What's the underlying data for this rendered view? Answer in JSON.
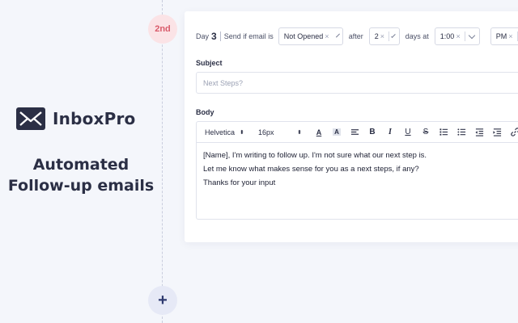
{
  "brand": {
    "name": "InboxPro",
    "tagline_line1": "Automated",
    "tagline_line2": "Follow-up emails"
  },
  "timeline": {
    "step_label": "2nd",
    "add_symbol": "+"
  },
  "rule": {
    "day_label": "Day",
    "day_number": "3",
    "send_if_label": "Send if email is",
    "status_value": "Not Opened",
    "after_label": "after",
    "days_value": "2",
    "days_at_label": "days at",
    "time_value": "1:00",
    "ampm_value": "PM"
  },
  "subject": {
    "label": "Subject",
    "placeholder": "Next Steps?"
  },
  "body": {
    "label": "Body",
    "font_value": "Helvetica",
    "size_value": "16px",
    "lines": [
      "[Name], I'm writing to follow up. I'm not sure what our next step is.",
      "Let me know what makes sense for you as a next steps, if any?",
      "Thanks for your input"
    ]
  },
  "icons": {
    "bold": "B",
    "italic": "I",
    "underline": "U",
    "strike": "S",
    "text_color": "A",
    "highlight": "A"
  },
  "colors": {
    "badge_bg": "#fbe3e6",
    "badge_text": "#d95b6b",
    "brand_text": "#2b2f45",
    "add_bg": "#e6e9f6"
  }
}
